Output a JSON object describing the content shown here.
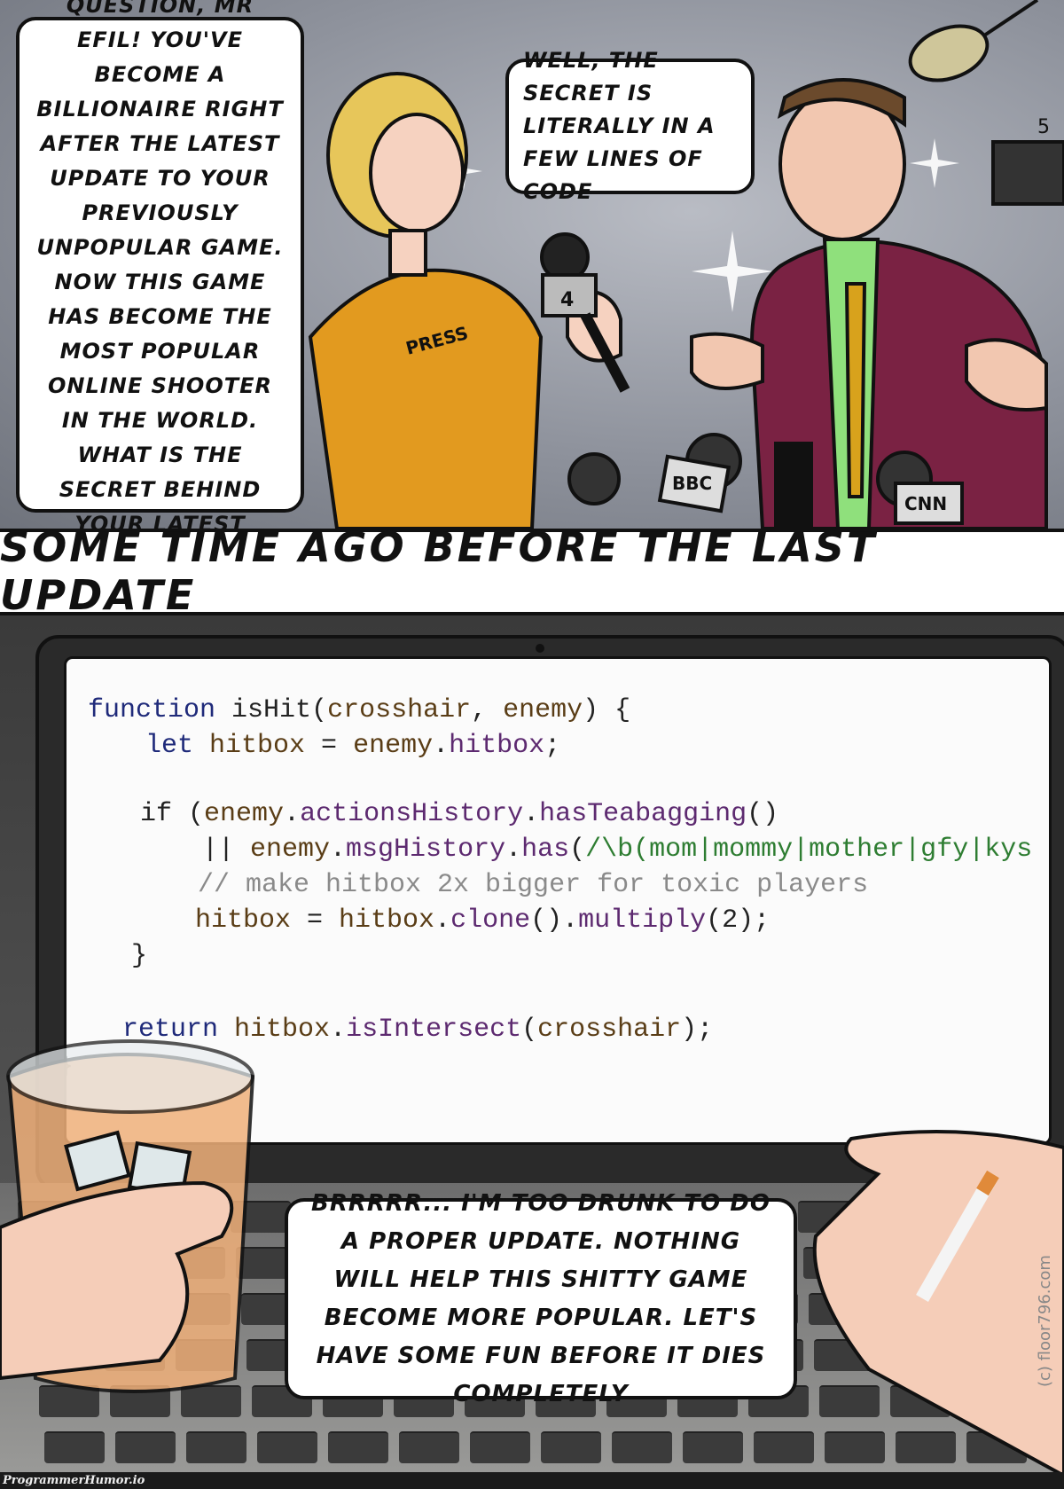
{
  "top_panel": {
    "reporter_speech": "... And one more question, Mr Efil! You've become a billionaire right after the latest update to your previously unpopular game. Now this game has become the most popular online shooter in the world. What is the secret behind your latest update?",
    "developer_speech": "Well, the secret is literally in a few lines of code",
    "press_badge": "PRESS",
    "mic_labels": [
      "4",
      "BBC",
      "CNN",
      "5"
    ]
  },
  "caption": "Some time ago before the last update",
  "code": {
    "lines": [
      [
        {
          "t": "function ",
          "c": "kw"
        },
        {
          "t": "isHit",
          "c": "pn"
        },
        {
          "t": "(",
          "c": "pn"
        },
        {
          "t": "crosshair",
          "c": "id"
        },
        {
          "t": ", ",
          "c": "pn"
        },
        {
          "t": "enemy",
          "c": "id"
        },
        {
          "t": ") {",
          "c": "pn"
        }
      ],
      [
        {
          "t": "let ",
          "c": "kw"
        },
        {
          "t": "hitbox",
          "c": "id"
        },
        {
          "t": " = ",
          "c": "pn"
        },
        {
          "t": "enemy",
          "c": "id"
        },
        {
          "t": ".",
          "c": "pn"
        },
        {
          "t": "hitbox",
          "c": "fn"
        },
        {
          "t": ";",
          "c": "pn"
        }
      ],
      [
        {
          "t": "if ",
          "c": "pn"
        },
        {
          "t": "(",
          "c": "pn"
        },
        {
          "t": "enemy",
          "c": "id"
        },
        {
          "t": ".",
          "c": "pn"
        },
        {
          "t": "actionsHistory",
          "c": "fn"
        },
        {
          "t": ".",
          "c": "pn"
        },
        {
          "t": "hasTeabagging",
          "c": "fn"
        },
        {
          "t": "()",
          "c": "pn"
        }
      ],
      [
        {
          "t": "|| ",
          "c": "pn"
        },
        {
          "t": "enemy",
          "c": "id"
        },
        {
          "t": ".",
          "c": "pn"
        },
        {
          "t": "msgHistory",
          "c": "fn"
        },
        {
          "t": ".",
          "c": "pn"
        },
        {
          "t": "has",
          "c": "fn"
        },
        {
          "t": "(",
          "c": "pn"
        },
        {
          "t": "/\\b(mom|mommy|mother|gfy|kys",
          "c": "re"
        }
      ],
      [
        {
          "t": "// make hitbox 2x bigger for toxic players",
          "c": "cm"
        }
      ],
      [
        {
          "t": "hitbox",
          "c": "id"
        },
        {
          "t": " = ",
          "c": "pn"
        },
        {
          "t": "hitbox",
          "c": "id"
        },
        {
          "t": ".",
          "c": "pn"
        },
        {
          "t": "clone",
          "c": "fn"
        },
        {
          "t": "().",
          "c": "pn"
        },
        {
          "t": "multiply",
          "c": "fn"
        },
        {
          "t": "(2);",
          "c": "pn"
        }
      ],
      [
        {
          "t": "}",
          "c": "pn"
        }
      ],
      [
        {
          "t": "return ",
          "c": "kw"
        },
        {
          "t": "hitbox",
          "c": "id"
        },
        {
          "t": ".",
          "c": "pn"
        },
        {
          "t": "isIntersect",
          "c": "fn"
        },
        {
          "t": "(",
          "c": "pn"
        },
        {
          "t": "crosshair",
          "c": "id"
        },
        {
          "t": ");",
          "c": "pn"
        }
      ],
      [
        {
          "t": "}",
          "c": "pn"
        }
      ]
    ]
  },
  "bottom_panel": {
    "developer_speech": "Brrrrr... I'm too drunk to do a proper update. Nothing will help this shitty game become more popular. Let's have some fun before it dies completely"
  },
  "watermark": "(c) floor796.com",
  "footer": "ProgrammerHumor.io",
  "colors": {
    "keyword": "#1f2a7a",
    "identifier": "#5a3d16",
    "method": "#5d2a70",
    "regex": "#2e7d32",
    "comment": "#8a8a8a"
  }
}
